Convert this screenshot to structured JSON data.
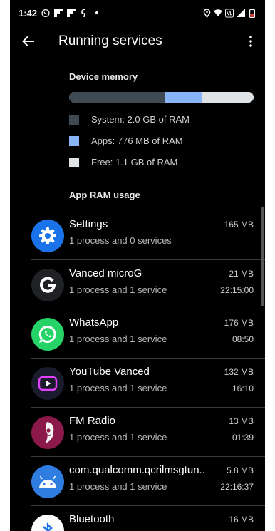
{
  "status": {
    "time": "1:42",
    "left_icons": [
      "whatsapp-icon",
      "flipboard-icon",
      "flipboard-icon",
      "gpay-icon",
      "dot-icon"
    ],
    "right_icons": [
      "location-icon",
      "wifi-icon",
      "volte-icon",
      "signal-icon",
      "battery-icon"
    ]
  },
  "appbar": {
    "title": "Running services"
  },
  "memory": {
    "heading": "Device memory",
    "bar": {
      "system_fraction": 0.52,
      "apps_fraction": 0.2,
      "free_fraction": 0.28
    },
    "legend": [
      {
        "label": "System: 2.0 GB of RAM",
        "color": "#3f4a52"
      },
      {
        "label": "Apps: 776 MB of RAM",
        "color": "#8ab4f8"
      },
      {
        "label": "Free: 1.1 GB of RAM",
        "color": "#dfe3e6"
      }
    ]
  },
  "usage": {
    "heading": "App RAM usage",
    "apps": [
      {
        "name": "Settings",
        "detail": "1 process and 0 services",
        "size": "165 MB",
        "time": "",
        "icon": "settings-icon",
        "icon_bg": "#1a73e8"
      },
      {
        "name": "Vanced microG",
        "detail": "1 process and 1 service",
        "size": "21 MB",
        "time": "22:15:00",
        "icon": "microg-icon",
        "icon_bg": "#202124"
      },
      {
        "name": "WhatsApp",
        "detail": "1 process and 1 service",
        "size": "176 MB",
        "time": "08:50",
        "icon": "whatsapp-icon",
        "icon_bg": "#25d366"
      },
      {
        "name": "YouTube Vanced",
        "detail": "1 process and 1 service",
        "size": "132 MB",
        "time": "16:10",
        "icon": "youtube-vanced-icon",
        "icon_bg": "#1b1b2e"
      },
      {
        "name": "FM Radio",
        "detail": "1 process and 1 service",
        "size": "13 MB",
        "time": "01:39",
        "icon": "fm-radio-icon",
        "icon_bg": "#8b1a4a"
      },
      {
        "name": "com.qualcomm.qcrilmsgtun..",
        "detail": "1 process and 1 service",
        "size": "5.8 MB",
        "time": "22:16:37",
        "icon": "android-icon",
        "icon_bg": "#2f7de1"
      },
      {
        "name": "Bluetooth",
        "detail": "",
        "size": "16 MB",
        "time": "",
        "icon": "bluetooth-icon",
        "icon_bg": "#ffffff"
      }
    ]
  }
}
